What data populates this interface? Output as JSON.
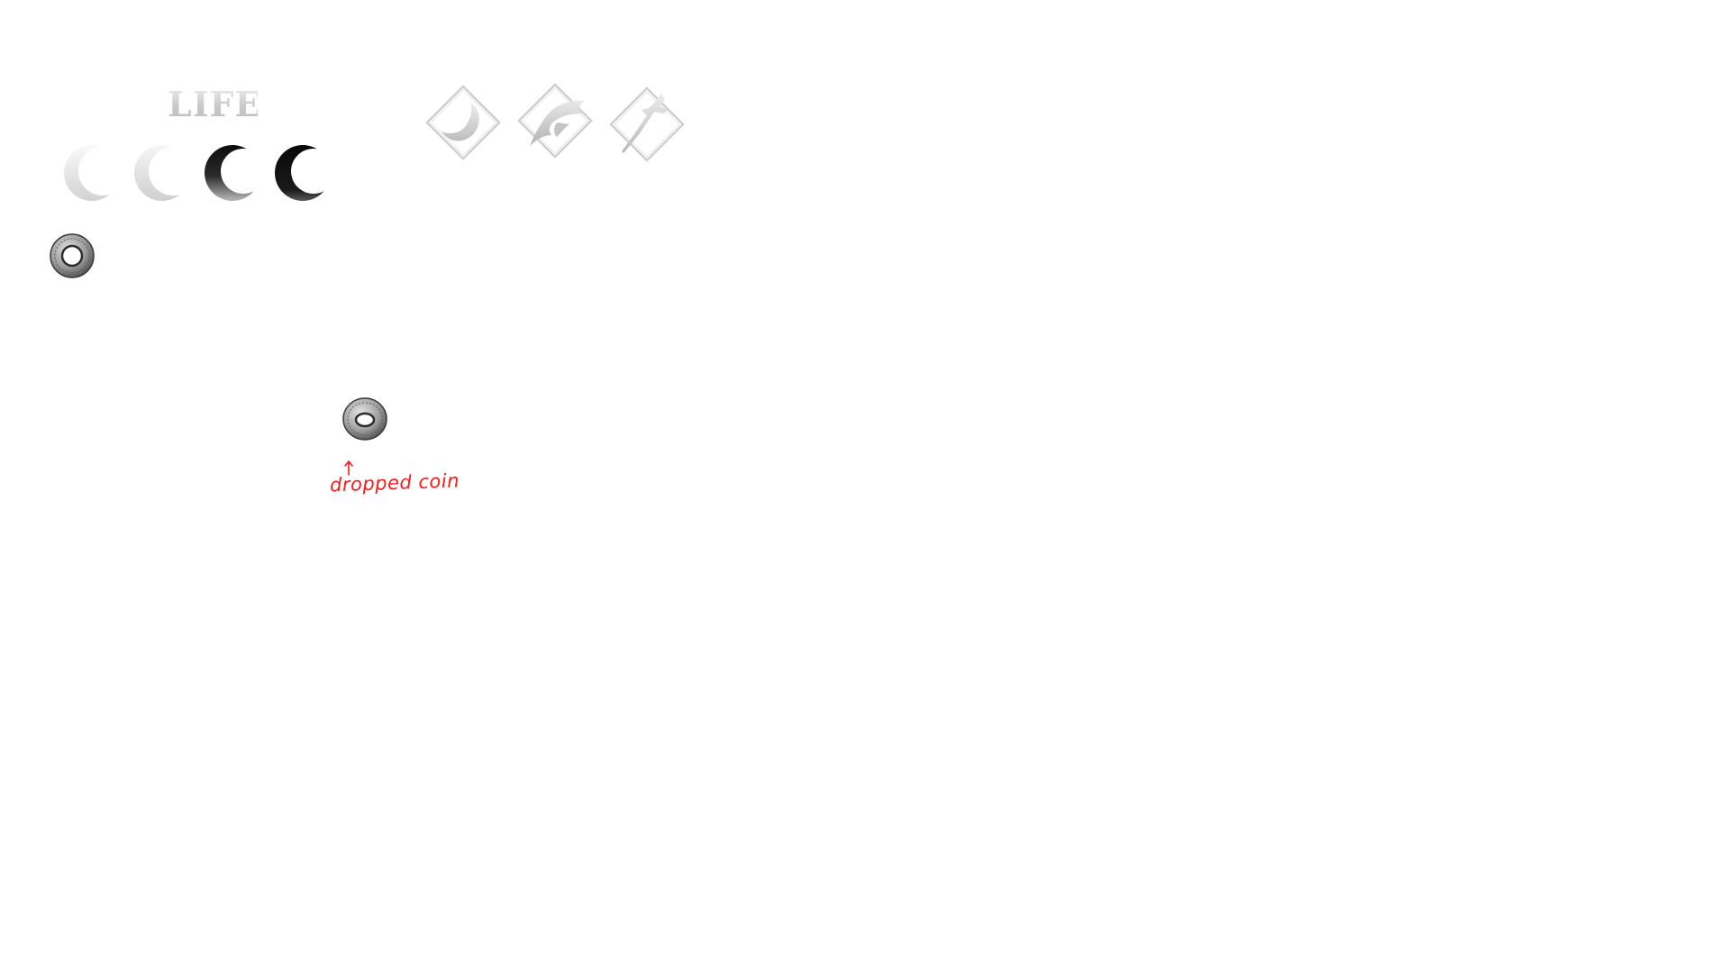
{
  "hud": {
    "life_label": "LIFE",
    "life": {
      "max": 4,
      "icons": [
        {
          "state": "faded",
          "icon": "crescent-moon-icon"
        },
        {
          "state": "faded",
          "icon": "crescent-moon-icon"
        },
        {
          "state": "partial",
          "icon": "crescent-moon-icon"
        },
        {
          "state": "full",
          "icon": "crescent-moon-icon"
        }
      ]
    },
    "abilities": [
      {
        "icon": "crescent-slash-diamond-icon"
      },
      {
        "icon": "claw-diamond-icon"
      },
      {
        "icon": "dagger-diamond-icon"
      }
    ],
    "currency": {
      "icon": "coin-icon"
    }
  },
  "world": {
    "dropped_coin": {
      "icon": "coin-icon"
    },
    "annotation": {
      "text": "dropped coin",
      "color": "#ff1a1a",
      "arrow": "up-arrow-icon"
    }
  },
  "colors": {
    "background": "#ffffff",
    "moon_dark": "#111111",
    "moon_faded": "#e8e8e8",
    "coin_silver": "#a8a8a8"
  }
}
